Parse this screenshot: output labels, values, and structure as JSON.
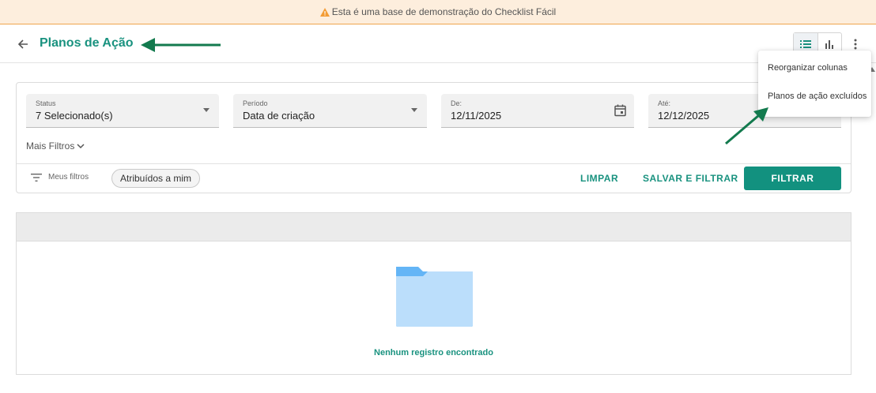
{
  "banner": {
    "text": "Esta é uma base de demonstração do Checklist Fácil",
    "icon": "warning-icon",
    "accent": "#f39c35"
  },
  "header": {
    "title": "Planos de Ação",
    "back_icon": "arrow-left-icon"
  },
  "view_toggle": {
    "list_icon": "list-view-icon",
    "chart_icon": "bar-chart-icon",
    "active": "list"
  },
  "more_menu": {
    "icon": "more-vert-icon",
    "items": [
      {
        "label": "Reorganizar colunas"
      },
      {
        "label": "Planos de ação excluídos"
      }
    ]
  },
  "filters": {
    "status": {
      "label": "Status",
      "value": "7 Selecionado(s)"
    },
    "period": {
      "label": "Período",
      "value": "Data de criação"
    },
    "from": {
      "label": "De:",
      "value": "12/11/2025"
    },
    "to": {
      "label": "Até:",
      "value": "12/12/2025"
    },
    "more_filters": "Mais Filtros",
    "my_filters": "Meus filtros",
    "chip": "Atribuídos a mim",
    "clear": "LIMPAR",
    "save_filter": "SALVAR E FILTRAR",
    "filter": "FILTRAR"
  },
  "table": {
    "empty_message": "Nenhum registro encontrado"
  },
  "colors": {
    "brand": "#19927f",
    "primary_button": "#12917f",
    "annotation_arrow": "#137a4e"
  }
}
